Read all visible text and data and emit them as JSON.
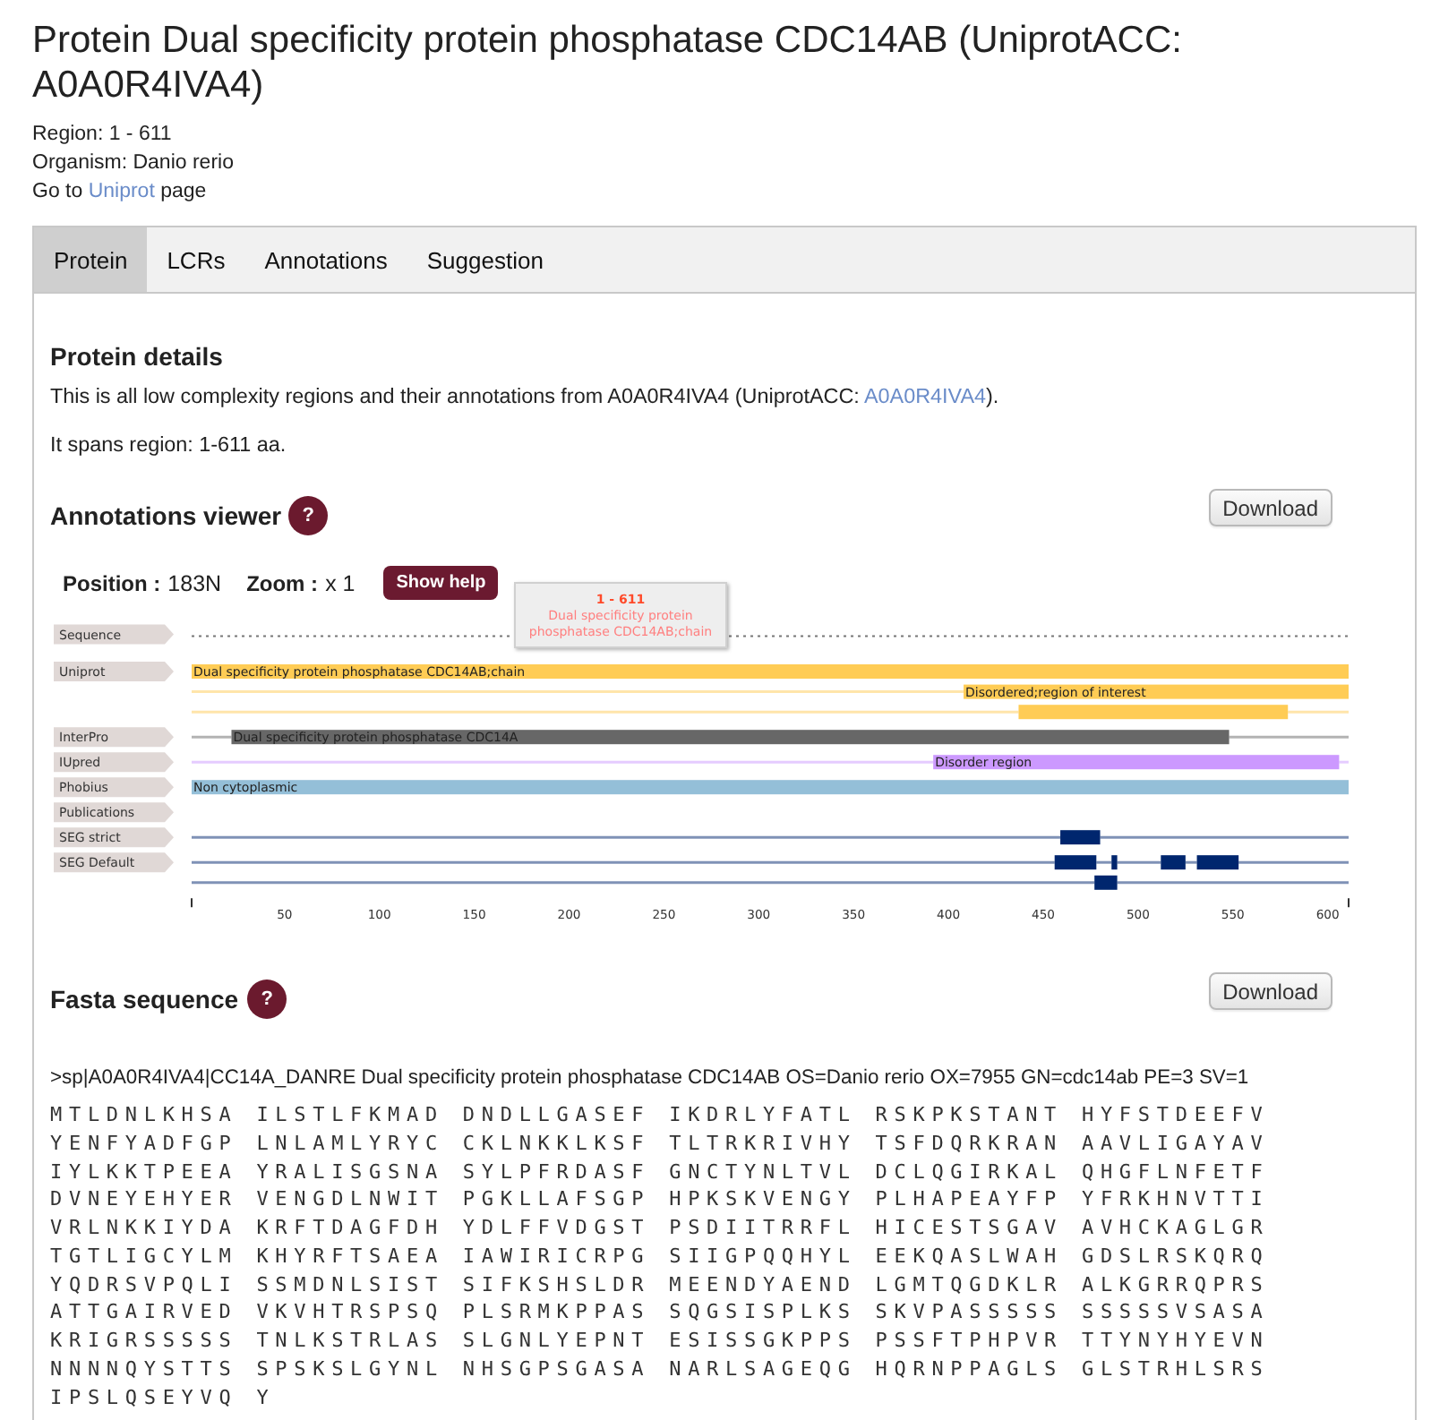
{
  "page": {
    "title": "Protein Dual specificity protein phosphatase CDC14AB (UniprotACC: A0A0R4IVA4)",
    "region": "Region: 1 - 611",
    "organism": "Organism: Danio rerio",
    "uniprot_line": {
      "before": "Go to ",
      "link": "Uniprot",
      "after": " page"
    }
  },
  "tabs": [
    {
      "label": "Protein",
      "selected": true
    },
    {
      "label": "LCRs",
      "selected": false
    },
    {
      "label": "Annotations",
      "selected": false
    },
    {
      "label": "Suggestion",
      "selected": false
    }
  ],
  "protein_details": {
    "heading": "Protein details",
    "description": {
      "before": "This is all low complexity regions and their annotations from A0A0R4IVA4 (UniprotACC: ",
      "link": "A0A0R4IVA4",
      "after": ")."
    },
    "span_text": "It spans region: 1-611 aa."
  },
  "annotations_viewer": {
    "heading": "Annotations viewer",
    "help": "?",
    "download": "Download",
    "position_label": "Position :",
    "position": "183N",
    "zoom_label": "Zoom :",
    "zoom": "x 1",
    "show_help": "Show help",
    "tooltip": {
      "range": "1 - 611",
      "text": "Dual specificity protein phosphatase CDC14AB;chain"
    },
    "tracks": [
      {
        "label": "Sequence",
        "kind": "sequence"
      },
      {
        "label": "Uniprot",
        "kind": "features",
        "lanes": [
          {
            "features": [
              {
                "text": "Dual specificity protein phosphatase CDC14AB;chain",
                "color": "#ffcc55"
              }
            ]
          },
          {
            "features": [
              {
                "text": "Disordered;region of interest",
                "color": "#ffcc55"
              }
            ]
          },
          {
            "features": [
              {
                "color": "#ffcc55"
              }
            ]
          }
        ]
      },
      {
        "label": "InterPro",
        "kind": "features",
        "lanes": [
          {
            "features": [
              {
                "text": "Dual specificity protein phosphatase CDC14A",
                "color": "#676767"
              }
            ]
          }
        ]
      },
      {
        "label": "IUpred",
        "kind": "features",
        "lanes": [
          {
            "features": [
              {
                "text": "Disorder region",
                "color": "#cc99ff"
              }
            ]
          }
        ]
      },
      {
        "label": "Phobius",
        "kind": "features",
        "lanes": [
          {
            "features": [
              {
                "text": "Non cytoplasmic",
                "color": "#94bfd8"
              }
            ]
          }
        ]
      },
      {
        "label": "Publications",
        "kind": "features"
      },
      {
        "label": "SEG strict",
        "kind": "features",
        "lanes": [
          {
            "features": [
              {
                "color": "#00266e"
              }
            ]
          }
        ]
      },
      {
        "label": "SEG Default",
        "kind": "features",
        "lanes": [
          {
            "features": [
              {
                "color": "#00266e"
              },
              {
                "color": "#00266e"
              },
              {
                "color": "#00266e"
              },
              {
                "color": "#00266e"
              }
            ]
          },
          {
            "features": [
              {
                "color": "#00266e"
              }
            ]
          }
        ]
      }
    ],
    "ruler": [
      "50",
      "100",
      "150",
      "200",
      "250",
      "300",
      "350",
      "400",
      "450",
      "500",
      "550",
      "600"
    ]
  },
  "fasta": {
    "heading": "Fasta sequence",
    "help": "?",
    "download": "Download",
    "header": ">sp|A0A0R4IVA4|CC14A_DANRE Dual specificity protein phosphatase CDC14AB OS=Danio rerio OX=7955 GN=cdc14ab PE=3 SV=1",
    "lines": [
      "MTLDNLKHSA ILSTLFKMAD DNDLLGASEF IKDRLYFATL RSKPKSTANT HYFSTDEEFV",
      "YENFYADFGP LNLAMLYRYC CKLNKKLKSF TLTRKRIVHY TSFDQRKRAN AAVLIGAYAV",
      "IYLKKTPEEA YRALISGSNA SYLPFRDASF GNCTYNLTVL DCLQGIRKAL QHGFLNFETF",
      "DVNEYEHYER VENGDLNWIT PGKLLAFSGP HPKSKVENGY PLHAPEAYFP YFRKHNVTTI",
      "VRLNKKIYDA KRFTDAGFDH YDLFFVDGST PSDIITRRFL HICESTSGAV AVHCKAGLGR",
      "TGTLIGCYLM KHYRFTSAEA IAWIRICRPG SIIGPQQHYL EEKQASLWAH GDSLRSKQRQ",
      "YQDRSVPQLI SSMDNLSIST SIFKSHSLDR MEENDYAEND LGMTQGDKLR ALKGRRQPRS",
      "ATTGAIRVED VKVHTRSPSQ PLSRMKPPAS SQGSISPLKS SKVPASSSSS SSSSSVSASA",
      "KRIGRSSSSS TNLKSTRLAS SLGNLYEPNT ESISSGKPPS PSSFTPHPVR TTYNYHYEVN",
      "NNNNQYSTTS SPSKSLGYNL NHSGPSGASA NARLSAGEQG HQRNPPAGLS GLSTRHLSRS",
      "IPSLQSEYVQ Y"
    ]
  }
}
